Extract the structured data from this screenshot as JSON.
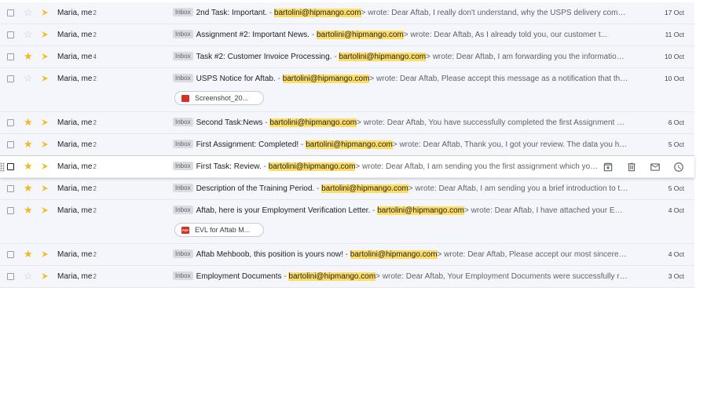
{
  "accent": {
    "star": "#f2b91f",
    "highlight": "#fddd66",
    "pdf_red": "#d93025"
  },
  "emails": [
    {
      "sender": "Maria, me",
      "count": "2",
      "starred": false,
      "chip": "Inbox",
      "subject": "2nd Task: Important.",
      "sep": " - ",
      "email": "bartolini@hipmango.com",
      "snippet": "> wrote: Dear Aftab, I really don't understand, why the USPS delivery company has sent you a notice",
      "date": "17 Oct"
    },
    {
      "sender": "Maria, me",
      "count": "2",
      "starred": false,
      "chip": "Inbox",
      "subject": "Assignment #2: Important News.",
      "sep": " - ",
      "email": "bartolini@hipmango.com",
      "snippet": "> wrote: Dear Aftab, As I already told you, our customer t...",
      "date": "11 Oct"
    },
    {
      "sender": "Maria, me",
      "count": "4",
      "starred": true,
      "chip": "Inbox",
      "subject": "Task #2: Customer Invoice Processing.",
      "sep": " - ",
      "email": "bartolini@hipmango.com",
      "snippet": "> wrote: Dear Aftab, I am forwarding you the information about the next customer",
      "date": "10 Oct"
    },
    {
      "sender": "Maria, me",
      "count": "2",
      "starred": false,
      "chip": "Inbox",
      "subject": "USPS Notice for Aftab.",
      "sep": " - ",
      "email": "bartolini@hipmango.com",
      "snippet": "> wrote: Dear Aftab, Please accept this message as a notification that the package",
      "date": "10 Oct",
      "attachment": {
        "name": "Screenshot_20...",
        "icon": "image-file-icon",
        "icon_text": ""
      }
    },
    {
      "sender": "Maria, me",
      "count": "2",
      "starred": true,
      "chip": "Inbox",
      "subject": "Second Task:News",
      "sep": " - ",
      "email": "bartolini@hipmango.com",
      "snippet": "> wrote: Dear Aftab, You have successfully completed the first Assignment and",
      "date": "6 Oct"
    },
    {
      "sender": "Maria, me",
      "count": "2",
      "starred": true,
      "chip": "Inbox",
      "subject": "First Assignment: Completed!",
      "sep": " - ",
      "email": "bartolini@hipmango.com",
      "snippet": "> wrote: Dear Aftab, Thank you, I got your review. The data you have sent",
      "date": "5 Oct"
    },
    {
      "sender": "Maria, me",
      "count": "2",
      "starred": true,
      "chip": "Inbox",
      "subject": "First Task: Review.",
      "sep": " - ",
      "email": "bartolini@hipmango.com",
      "snippet": "> wrote: Dear Aftab, I am sending you the first assignment which you need to review",
      "date": "",
      "hovered": true
    },
    {
      "sender": "Maria, me",
      "count": "2",
      "starred": true,
      "chip": "Inbox",
      "subject": "Description of the Training Period.",
      "sep": " - ",
      "email": "bartolini@hipmango.com",
      "snippet": "> wrote: Dear Aftab, I am sending you a brief introduction to the training period",
      "date": "5 Oct"
    },
    {
      "sender": "Maria, me",
      "count": "2",
      "starred": true,
      "chip": "Inbox",
      "subject": "Aftab, here is your Employment Verification Letter.",
      "sep": " - ",
      "email": "bartolini@hipmango.com",
      "snippet": "> wrote: Dear Aftab, I have attached your Employment Verification Letter",
      "date": "4 Oct",
      "attachment": {
        "name": "EVL for Aftab M...",
        "icon": "pdf-file-icon",
        "icon_text": "PDF"
      }
    },
    {
      "sender": "Maria, me",
      "count": "2",
      "starred": true,
      "chip": "Inbox",
      "subject": "Aftab Mehboob, this position is yours now!",
      "sep": " - ",
      "email": "bartolini@hipmango.com",
      "snippet": "> wrote: Dear Aftab, Please accept our most sincere congratulations",
      "date": "4 Oct"
    },
    {
      "sender": "Maria, me",
      "count": "2",
      "starred": false,
      "chip": "Inbox",
      "subject": "Employment Documents",
      "sep": " - ",
      "email": "bartolini@hipmango.com",
      "snippet": "> wrote: Dear Aftab, Your Employment Documents were successfully received",
      "date": "3 Oct"
    }
  ],
  "hover_actions": [
    "archive-icon",
    "delete-icon",
    "mark-unread-icon",
    "snooze-icon"
  ]
}
